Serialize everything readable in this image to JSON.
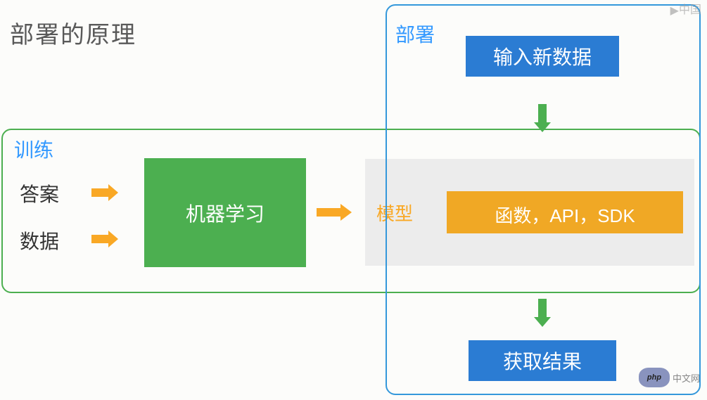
{
  "title": "部署的原理",
  "training": {
    "label": "训练",
    "answer": "答案",
    "data": "数据",
    "ml_box": "机器学习"
  },
  "deploy": {
    "label": "部署",
    "input_box": "输入新数据",
    "result_box": "获取结果"
  },
  "model": {
    "label": "模型",
    "functions": "函数，API，SDK"
  },
  "logo": {
    "badge": "php",
    "text": "中文网"
  },
  "watermark": "中国"
}
